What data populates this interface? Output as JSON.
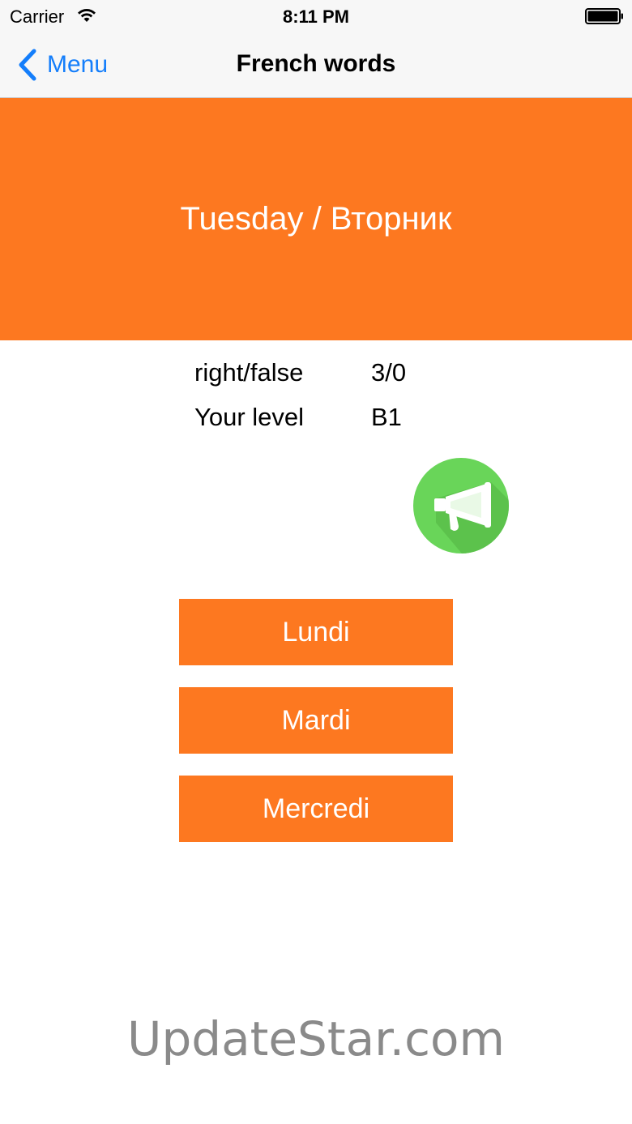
{
  "status_bar": {
    "carrier": "Carrier",
    "time": "8:11 PM",
    "wifi_icon": "wifi-icon",
    "battery_icon": "battery-full-icon"
  },
  "nav": {
    "back_label": "Menu",
    "back_icon": "chevron-left-icon",
    "title": "French words",
    "tint_color": "#147efb"
  },
  "question": {
    "word": "Tuesday / Вторник",
    "background_color": "#fd7820"
  },
  "stats": {
    "score_label": "right/false",
    "score_value": "3/0",
    "level_label": "Your level",
    "level_value": "B1"
  },
  "speak_button": {
    "icon": "megaphone-icon",
    "color": "#69d559"
  },
  "answers": [
    {
      "label": "Lundi"
    },
    {
      "label": "Mardi"
    },
    {
      "label": "Mercredi"
    }
  ],
  "answer_button_color": "#fd7820",
  "watermark": "UpdateStar.com"
}
